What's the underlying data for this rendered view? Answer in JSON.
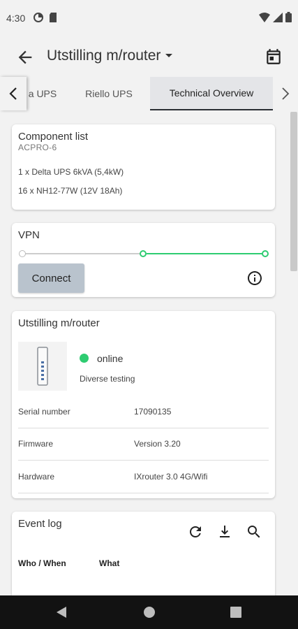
{
  "status_bar": {
    "time": "4:30"
  },
  "app_bar": {
    "title": "Utstilling m/router"
  },
  "tabs": [
    {
      "label": "a UPS"
    },
    {
      "label": "Riello UPS"
    },
    {
      "label": "Technical Overview"
    }
  ],
  "component_list": {
    "title": "Component list",
    "subtitle": "ACPRO-6",
    "items": [
      "1 x Delta UPS 6kVA (5,4kW)",
      "16 x NH12-77W (12V 18Ah)"
    ]
  },
  "vpn": {
    "title": "VPN",
    "connect_label": "Connect"
  },
  "router": {
    "title": "Utstilling m/router",
    "status": "online",
    "status_color": "#2ecc71",
    "description": "Diverse testing",
    "rows": [
      {
        "label": "Serial number",
        "value": "17090135"
      },
      {
        "label": "Firmware",
        "value": "Version 3.20"
      },
      {
        "label": "Hardware",
        "value": "IXrouter 3.0 4G/Wifi"
      }
    ]
  },
  "event_log": {
    "title": "Event log",
    "columns": [
      "Who / When",
      "What"
    ],
    "icons": [
      "refresh-icon",
      "download-icon",
      "search-icon"
    ]
  },
  "colors": {
    "accent_green": "#2ecc71",
    "button_grey": "#b9c3cd",
    "nav_bar": "#121212"
  }
}
